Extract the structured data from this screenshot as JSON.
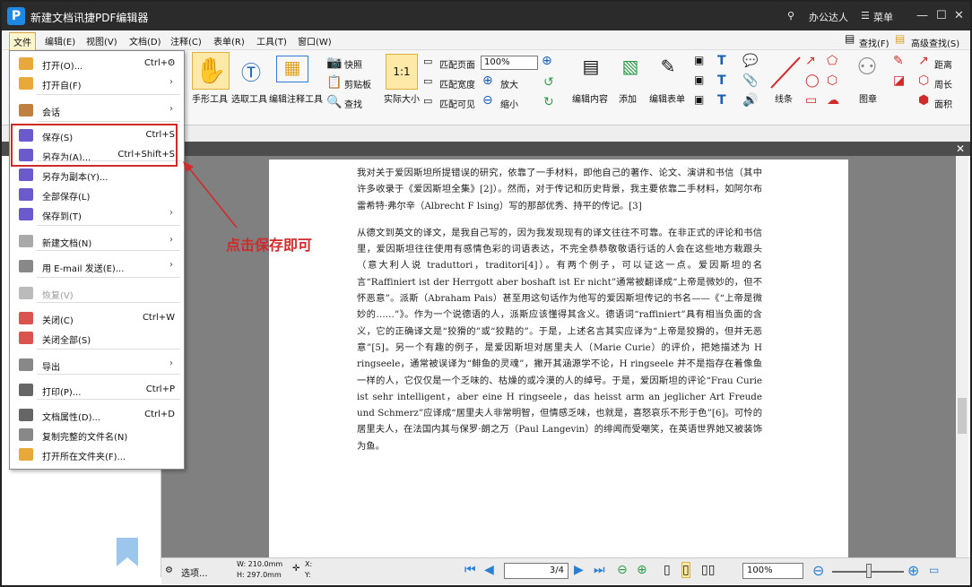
{
  "app": {
    "title": "新建文档讯捷PDF编辑器",
    "icon": "P",
    "user": "办公达人",
    "menu_label": "菜单"
  },
  "menubar": [
    "文件",
    "编辑(E)",
    "视图(V)",
    "文档(D)",
    "注释(C)",
    "表单(R)",
    "工具(T)",
    "窗口(W)"
  ],
  "ribbon": {
    "hand_tool": "手形工具",
    "select_tool": "选取工具",
    "edit_annotation_tool": "编辑注释工具",
    "snapshot": "快照",
    "clipboard": "剪贴板",
    "find": "查找",
    "actual_size": "实际大小",
    "fit_page": "匹配页面",
    "fit_width": "匹配宽度",
    "fit_visible": "匹配可见",
    "zoom_value": "100%",
    "zoom_in": "放大",
    "zoom_out": "缩小",
    "edit_content": "编辑内容",
    "add": "添加",
    "edit_form": "编辑表单",
    "lines": "线条",
    "stamp": "图章",
    "find_right": "查找(F)",
    "advanced_find": "高级查找(S)",
    "distance": "距离",
    "perimeter": "周长",
    "area": "面积"
  },
  "file_menu": [
    {
      "label": "打开(O)...",
      "shortcut": "Ctrl+O",
      "arrow": "›",
      "icon": "folder-open-icon",
      "color": "#e8a93a"
    },
    {
      "label": "打开自(F)",
      "shortcut": "",
      "arrow": "›",
      "icon": "folder-open-from-icon",
      "color": "#e8a93a"
    },
    {
      "label": "会话",
      "shortcut": "",
      "arrow": "›",
      "icon": "session-icon",
      "color": "#c08040"
    },
    {
      "label": "保存(S)",
      "shortcut": "Ctrl+S",
      "arrow": "",
      "icon": "save-icon",
      "color": "#6a5acd"
    },
    {
      "label": "另存为(A)...",
      "shortcut": "Ctrl+Shift+S",
      "arrow": "",
      "icon": "save-as-icon",
      "color": "#6a5acd"
    },
    {
      "label": "另存为副本(Y)...",
      "shortcut": "",
      "arrow": "",
      "icon": "save-copy-icon",
      "color": "#6a5acd"
    },
    {
      "label": "全部保存(L)",
      "shortcut": "",
      "arrow": "",
      "icon": "save-all-icon",
      "color": "#6a5acd"
    },
    {
      "label": "保存到(T)",
      "shortcut": "",
      "arrow": "›",
      "icon": "save-to-icon",
      "color": "#6a5acd"
    },
    {
      "label": "新建文档(N)",
      "shortcut": "",
      "arrow": "›",
      "icon": "new-document-icon",
      "color": "#aaaaaa"
    },
    {
      "label": "用 E-mail 发送(E)...",
      "shortcut": "",
      "arrow": "›",
      "icon": "email-icon",
      "color": "#888888"
    },
    {
      "label": "恢复(V)",
      "shortcut": "",
      "arrow": "",
      "icon": "restore-icon",
      "color": "#bbbbbb"
    },
    {
      "label": "关闭(C)",
      "shortcut": "Ctrl+W",
      "arrow": "",
      "icon": "close-document-icon",
      "color": "#d9534f"
    },
    {
      "label": "关闭全部(S)",
      "shortcut": "",
      "arrow": "",
      "icon": "close-all-icon",
      "color": "#d9534f"
    },
    {
      "label": "导出",
      "shortcut": "",
      "arrow": "›",
      "icon": "export-icon",
      "color": "#888888"
    },
    {
      "label": "打印(P)...",
      "shortcut": "Ctrl+P",
      "arrow": "",
      "icon": "print-icon",
      "color": "#666666"
    },
    {
      "label": "文档属性(D)...",
      "shortcut": "Ctrl+D",
      "arrow": "",
      "icon": "properties-icon",
      "color": "#666666"
    },
    {
      "label": "复制完整的文件名(N)",
      "shortcut": "",
      "arrow": "",
      "icon": "copy-filename-icon",
      "color": "#888888"
    },
    {
      "label": "打开所在文件夹(F)...",
      "shortcut": "",
      "arrow": "",
      "icon": "open-folder-icon",
      "color": "#e8a93a"
    }
  ],
  "annotation": "点击保存即可",
  "document": {
    "paragraphs": [
      "我对关于爱因斯坦所提错误的研究，依靠了一手材料，即他自己的著作、论文、演讲和书信（其中许多收录于《爱因斯坦全集》[2]）。然而，对于传记和历史背景，我主要依靠二手材料，如阿尔布雷希特·弗尔辛（Albrecht F lsing）写的那部优秀、持平的传记。[3]",
      "从德文到英文的译文，是我自己写的，因为我发现现有的译文往往不可靠。在非正式的评论和书信里，爱因斯坦往往使用有感情色彩的词语表达，不完全恭恭敬敬语行话的人会在这些地方栽跟头（意大利人说 traduttori，traditori[4]）。有两个例子，可以证这一点。爱因斯坦的名言“Raffiniert ist der Herrgott aber boshaft ist Er nicht”通常被翻译成“上帝是微妙的，但不怀恶意”。派斯（Abraham Pais）甚至用这句话作为他写的爱因斯坦传记的书名——《“上帝是微妙的……”》。作为一个说德语的人，派斯应该懂得其含义。德语词“raffiniert”具有相当负面的含义，它的正确译文是“狡猾的”或“狡黠的”。于是，上述名言其实应译为“上帝是狡猾的，但并无恶意”[5]。另一个有趣的例子，是爱因斯坦对居里夫人（Marie Curie）的评价，把她描述为 H ringseele，通常被误译为“鲱鱼的灵魂”，撇开其涵源学不论，H ringseele 并不是指存在着像鱼一样的人，它仅仅是一个乏味的、枯燥的或冷漠的人的绰号。于是，爱因斯坦的评论“Frau Curie ist sehr intelligent，aber eine H ringseele，das heisst arm an jeglicher Art Freude und Schmerz”应译成“居里夫人非常明智，但情感乏味，也就是，喜怒哀乐不形于色”[6]。可怜的居里夫人，在法国内其与保罗·朗之万（Paul Langevin）的绯闻而受嘲笑，在英语世界她又被装饰为鱼。"
    ]
  },
  "statusbar": {
    "options": "选项...",
    "width": "W: 210.0mm",
    "height": "H: 297.0mm",
    "x": "X:",
    "y": "Y:",
    "page": "3/4",
    "zoom": "100%"
  }
}
